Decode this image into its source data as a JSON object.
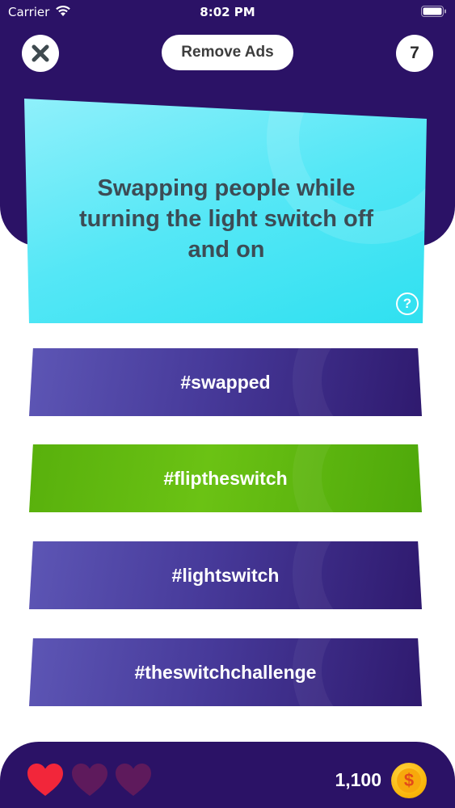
{
  "status_bar": {
    "carrier": "Carrier",
    "time": "8:02 PM"
  },
  "header": {
    "remove_ads_label": "Remove Ads",
    "level": "7"
  },
  "question": {
    "text": "Swapping people while turning the light switch off and on",
    "help_symbol": "?"
  },
  "answers": [
    {
      "label": "#swapped",
      "state": "default"
    },
    {
      "label": "#fliptheswitch",
      "state": "correct"
    },
    {
      "label": "#lightswitch",
      "state": "default"
    },
    {
      "label": "#theswitchchallenge",
      "state": "default"
    }
  ],
  "footer": {
    "lives_remaining": 1,
    "lives_total": 3,
    "coins": "1,100",
    "coin_symbol": "$"
  },
  "colors": {
    "background_purple": "#2b1266",
    "card_cyan": "#55e7f6",
    "answer_purple": "#473a9a",
    "answer_correct_green": "#6bc214",
    "heart_active": "#f2263a",
    "heart_inactive": "#5e1a5c",
    "coin_gold": "#f9b60a"
  }
}
